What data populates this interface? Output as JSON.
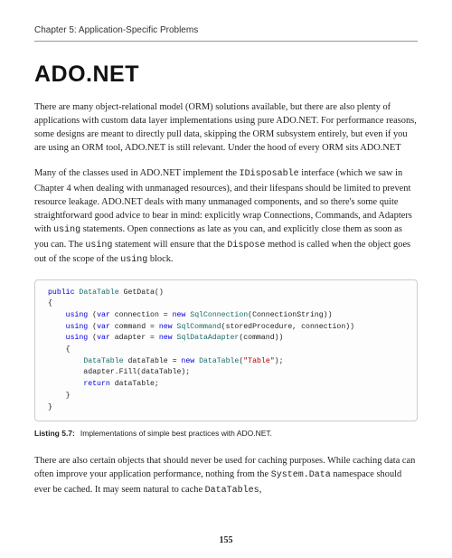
{
  "chapter_header": "Chapter 5: Application-Specific Problems",
  "heading": "ADO.NET",
  "para1_a": "There are many object-relational model (ORM) solutions available, but there are also plenty of applications with custom data layer implementations using pure ADO.NET. For performance reasons, some designs are meant to directly pull data, skipping the ORM subsystem entirely, but even if you are using an ORM tool, ADO.NET is still relevant. Under the hood of every ORM sits ADO.NET",
  "para2_a": "Many of the classes used in ADO.NET implement the ",
  "para2_code1": "IDisposable",
  "para2_b": " interface (which we saw in Chapter 4 when dealing with unmanaged resources), and their lifespans should be limited to prevent resource leakage. ADO.NET deals with many unmanaged components, and so there's some quite straightforward good advice to bear in mind: explicitly wrap Connections, Commands, and Adapters with ",
  "para2_code2": "using",
  "para2_c": " statements. Open connections as late as you can, and explicitly close them as soon as you can. The ",
  "para2_code3": "using",
  "para2_d": " statement will ensure that the ",
  "para2_code4": "Dispose",
  "para2_e": " method is called when the object goes out of the scope of the ",
  "para2_code5": "using",
  "para2_f": " block.",
  "code": {
    "l1a": "public",
    "l1b": "DataTable",
    "l1c": " GetData()",
    "l2": "{",
    "l3a": "    ",
    "l3b": "using",
    "l3c": " (",
    "l3d": "var",
    "l3e": " connection = ",
    "l3f": "new",
    "l3g": " ",
    "l3h": "SqlConnection",
    "l3i": "(ConnectionString))",
    "l4a": "    ",
    "l4b": "using",
    "l4c": " (",
    "l4d": "var",
    "l4e": " command = ",
    "l4f": "new",
    "l4g": " ",
    "l4h": "SqlCommand",
    "l4i": "(storedProcedure, connection))",
    "l5a": "    ",
    "l5b": "using",
    "l5c": " (",
    "l5d": "var",
    "l5e": " adapter = ",
    "l5f": "new",
    "l5g": " ",
    "l5h": "SqlDataAdapter",
    "l5i": "(command))",
    "l6": "    {",
    "l7a": "        ",
    "l7b": "DataTable",
    "l7c": " dataTable = ",
    "l7d": "new",
    "l7e": " ",
    "l7f": "DataTable",
    "l7g": "(",
    "l7h": "\"Table\"",
    "l7i": ");",
    "l8": "        adapter.Fill(dataTable);",
    "l9a": "        ",
    "l9b": "return",
    "l9c": " dataTable;",
    "l10": "    }",
    "l11": "}"
  },
  "listing_label": "Listing 5.7:",
  "listing_text": "Implementations of simple best practices with ADO.NET.",
  "para3_a": "There are also certain objects that should never be used for caching purposes. While caching data can often improve your application performance, nothing from the ",
  "para3_code1": "System.Data",
  "para3_b": " namespace should ever be cached. It may seem natural to cache ",
  "para3_code2": "DataTables",
  "para3_c": ",",
  "page_number": "155"
}
